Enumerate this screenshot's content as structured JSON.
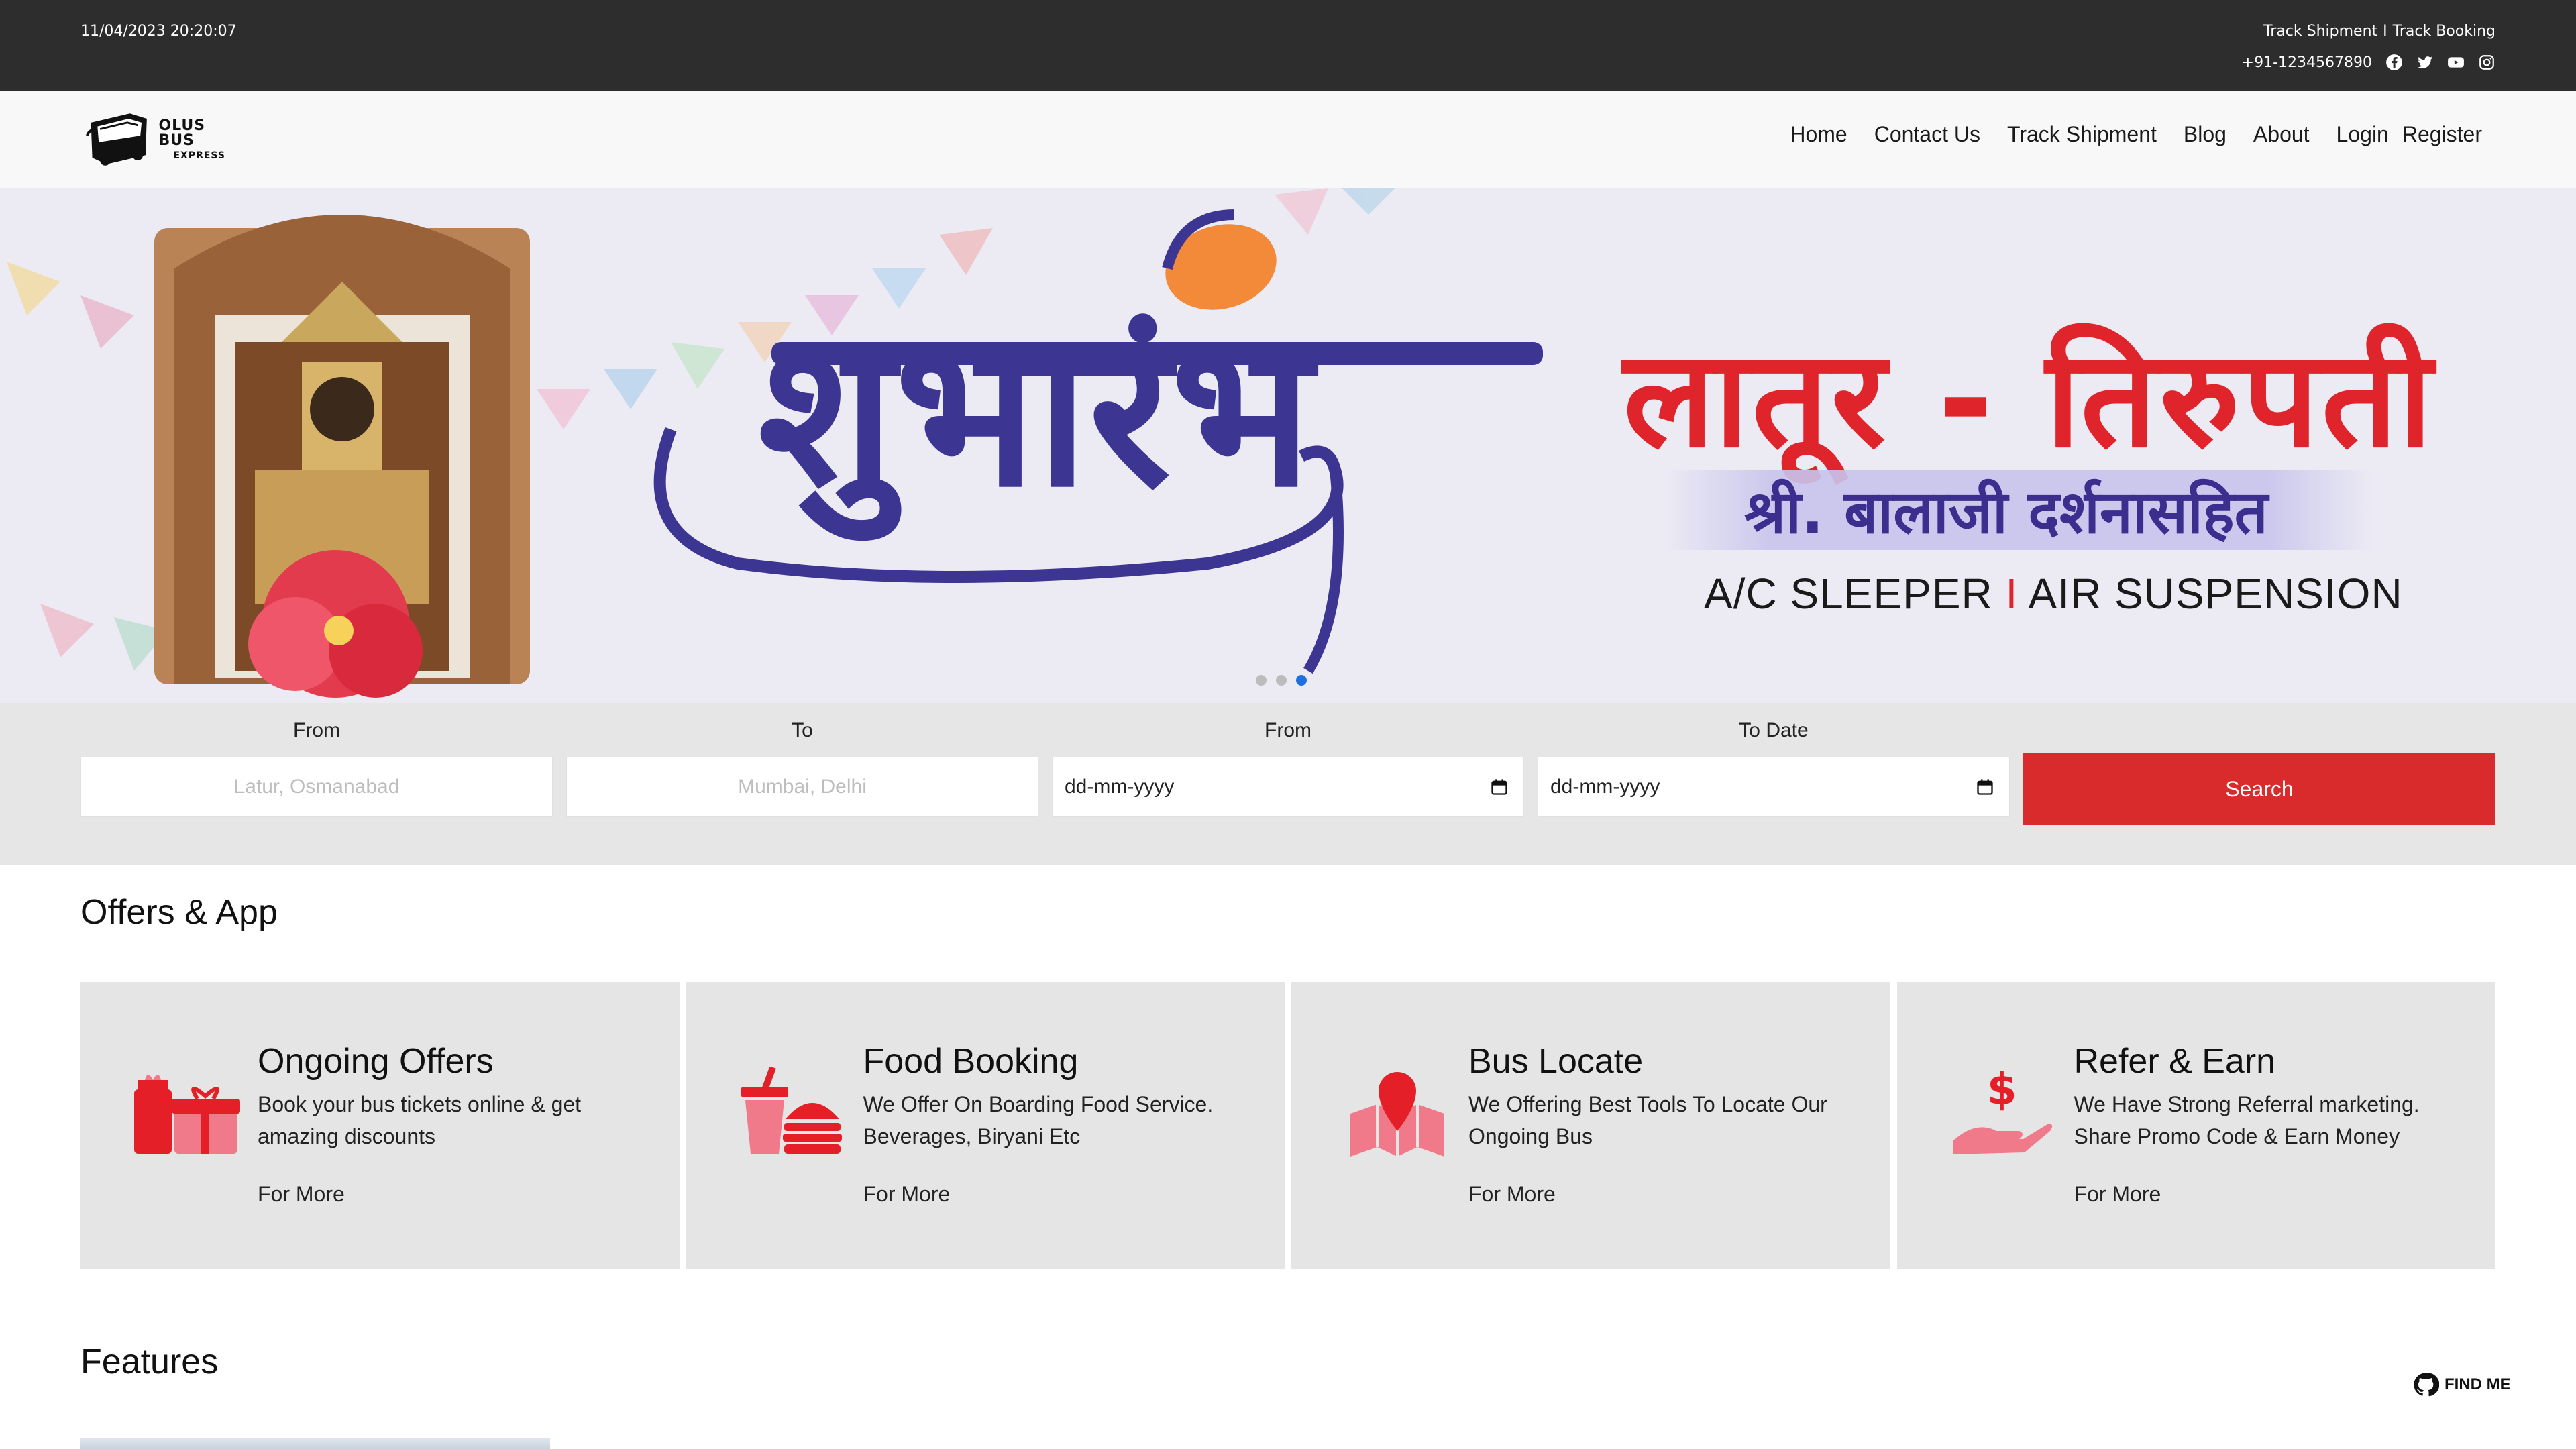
{
  "topbar": {
    "datetime": "11/04/2023 20:20:07",
    "links": [
      "Track Shipment",
      "I",
      "Track Booking"
    ],
    "phone": "+91-1234567890",
    "social_icons": [
      "facebook-icon",
      "twitter-icon",
      "youtube-icon",
      "instagram-icon"
    ]
  },
  "navbar": {
    "logo_line1": "OLUS BUS",
    "logo_line2": "EXPRESS",
    "links": [
      "Home",
      "Contact Us",
      "Track Shipment",
      "Blog",
      "About",
      "Login",
      "Register"
    ]
  },
  "hero": {
    "big_title": "शुभारंभ",
    "route_title": "लातूर - तिरुपती",
    "subtitle": "श्री. बालाजी दर्शनासहित",
    "features_left": "A/C SLEEPER",
    "features_sep": "I",
    "features_right": "AIR SUSPENSION",
    "slides": 3,
    "active_slide": 3
  },
  "search": {
    "from_label": "From",
    "from_placeholder": "Latur, Osmanabad",
    "to_label": "To",
    "to_placeholder": "Mumbai, Delhi",
    "from_date_label": "From",
    "from_date_value": "dd-mm-yyyy",
    "to_date_label": "To Date",
    "to_date_value": "dd-mm-yyyy",
    "button": "Search"
  },
  "offers": {
    "title": "Offers & App",
    "cards": [
      {
        "title": "Ongoing Offers",
        "desc": "Book your bus tickets online & get amazing discounts",
        "more": "For More",
        "icon": "gift-icon"
      },
      {
        "title": "Food Booking",
        "desc": "We Offer On Boarding Food Service. Beverages, Biryani Etc",
        "more": "For More",
        "icon": "food-icon"
      },
      {
        "title": "Bus Locate",
        "desc": "We Offering Best Tools To Locate Our Ongoing Bus",
        "more": "For More",
        "icon": "map-pin-icon"
      },
      {
        "title": "Refer & Earn",
        "desc": "We Have Strong Referral marketing. Share Promo Code & Earn Money",
        "more": "For More",
        "icon": "money-hand-icon"
      }
    ]
  },
  "features": {
    "title": "Features"
  },
  "findme": {
    "label": "FIND ME"
  },
  "colors": {
    "topbar": "#2d2d2d",
    "accent": "#d92b2b",
    "hero_blue": "#3c3592",
    "hero_red": "#e0242b"
  }
}
